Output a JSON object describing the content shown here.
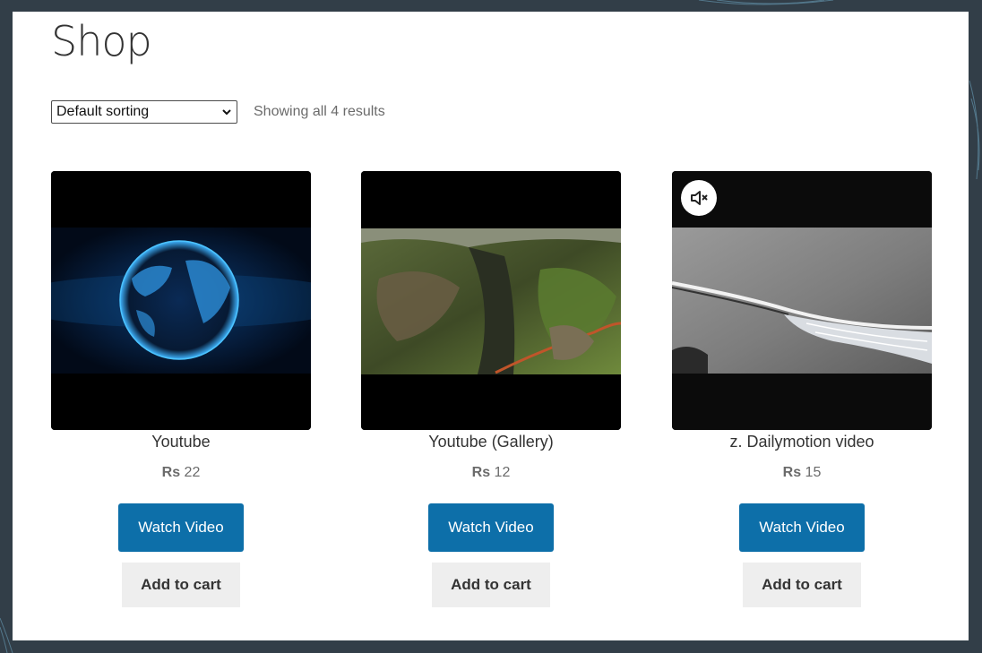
{
  "page": {
    "title": "Shop"
  },
  "toolbar": {
    "sort_selected": "Default sorting",
    "result_count": "Showing all 4 results"
  },
  "products": [
    {
      "name": "Youtube",
      "currency": "Rs",
      "price": "22",
      "watch_label": "Watch Video",
      "cart_label": "Add to cart",
      "thumbnail": "globe-video-thumbnail"
    },
    {
      "name": "Youtube (Gallery)",
      "currency": "Rs",
      "price": "12",
      "watch_label": "Watch Video",
      "cart_label": "Add to cart",
      "thumbnail": "canyon-video-thumbnail"
    },
    {
      "name": "z. Dailymotion video",
      "currency": "Rs",
      "price": "15",
      "watch_label": "Watch Video",
      "cart_label": "Add to cart",
      "thumbnail": "car-headlight-video-thumbnail",
      "mute_icon": "muted-speaker-icon"
    }
  ],
  "colors": {
    "outer_background": "#323e48",
    "watch_button": "#0d6fa9",
    "cart_button": "#eeeeee"
  }
}
